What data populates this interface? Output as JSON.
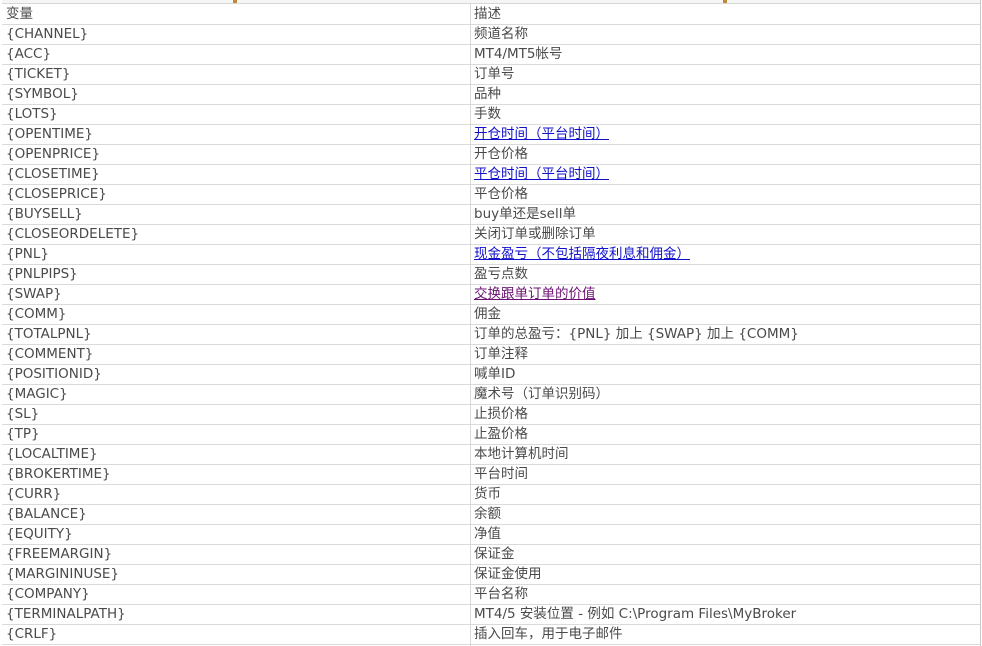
{
  "colors": {
    "text": "#4a4a4a",
    "link": "#1111cc",
    "visited_link": "#6b1174",
    "grid": "#dadada"
  },
  "table": {
    "headers": [
      "变量",
      "描述"
    ],
    "rows": [
      {
        "var": "{CHANNEL}",
        "desc": "频道名称",
        "style": "plain"
      },
      {
        "var": "{ACC}",
        "desc": "MT4/MT5帐号",
        "style": "plain"
      },
      {
        "var": "{TICKET}",
        "desc": "订单号",
        "style": "plain"
      },
      {
        "var": "{SYMBOL}",
        "desc": "品种",
        "style": "plain"
      },
      {
        "var": "{LOTS}",
        "desc": "手数",
        "style": "plain"
      },
      {
        "var": "{OPENTIME}",
        "desc": "开仓时间（平台时间）",
        "style": "link"
      },
      {
        "var": "{OPENPRICE}",
        "desc": "开仓价格",
        "style": "plain"
      },
      {
        "var": "{CLOSETIME}",
        "desc": "平仓时间（平台时间）",
        "style": "link"
      },
      {
        "var": "{CLOSEPRICE}",
        "desc": "平仓价格",
        "style": "plain"
      },
      {
        "var": "{BUYSELL}",
        "desc": "buy单还是sell单",
        "style": "plain"
      },
      {
        "var": "{CLOSEORDELETE}",
        "desc": "关闭订单或删除订单",
        "style": "plain"
      },
      {
        "var": "{PNL}",
        "desc": "现金盈亏（不包括隔夜利息和佣金）",
        "style": "link"
      },
      {
        "var": "{PNLPIPS}",
        "desc": "盈亏点数",
        "style": "plain"
      },
      {
        "var": "{SWAP}",
        "desc": "交换跟单订单的价值",
        "style": "visited"
      },
      {
        "var": "{COMM}",
        "desc": "佣金",
        "style": "plain"
      },
      {
        "var": "{TOTALPNL}",
        "desc": "订单的总盈亏：{PNL} 加上 {SWAP} 加上 {COMM}",
        "style": "plain"
      },
      {
        "var": "{COMMENT}",
        "desc": "订单注释",
        "style": "plain"
      },
      {
        "var": "{POSITIONID}",
        "desc": "喊单ID",
        "style": "plain"
      },
      {
        "var": "{MAGIC}",
        "desc": "魔术号（订单识别码）",
        "style": "plain"
      },
      {
        "var": "{SL}",
        "desc": "止损价格",
        "style": "plain"
      },
      {
        "var": "{TP}",
        "desc": "止盈价格",
        "style": "plain"
      },
      {
        "var": "{LOCALTIME}",
        "desc": "本地计算机时间",
        "style": "plain"
      },
      {
        "var": "{BROKERTIME}",
        "desc": "平台时间",
        "style": "plain"
      },
      {
        "var": "{CURR}",
        "desc": "货币",
        "style": "plain"
      },
      {
        "var": "{BALANCE}",
        "desc": "余额",
        "style": "plain"
      },
      {
        "var": "{EQUITY}",
        "desc": "净值",
        "style": "plain"
      },
      {
        "var": "{FREEMARGIN}",
        "desc": "保证金",
        "style": "plain"
      },
      {
        "var": "{MARGININUSE}",
        "desc": "保证金使用",
        "style": "plain"
      },
      {
        "var": "{COMPANY}",
        "desc": "平台名称",
        "style": "plain"
      },
      {
        "var": "{TERMINALPATH}",
        "desc": "MT4/5 安装位置 - 例如 C:\\Program Files\\MyBroker",
        "style": "plain"
      },
      {
        "var": "{CRLF}",
        "desc": "插入回车，用于电子邮件",
        "style": "plain"
      }
    ]
  }
}
